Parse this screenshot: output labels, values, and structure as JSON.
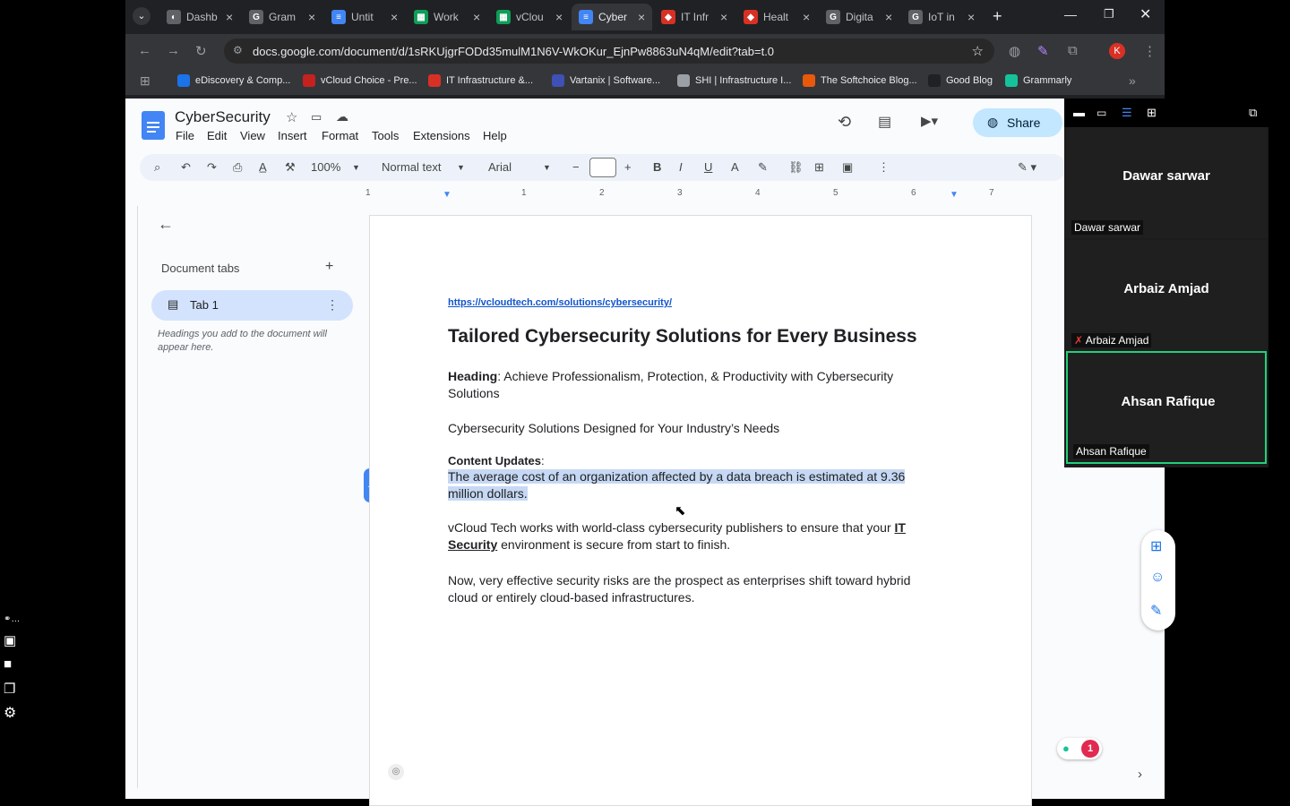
{
  "tabs": [
    {
      "title": "Dashb",
      "color": "#5f6368",
      "glyph": "◐"
    },
    {
      "title": "Gram",
      "color": "#5f6368",
      "glyph": "G"
    },
    {
      "title": "Untit",
      "color": "#4285f4",
      "glyph": "≡"
    },
    {
      "title": "Work",
      "color": "#0f9d58",
      "glyph": "▦"
    },
    {
      "title": "vClou",
      "color": "#0f9d58",
      "glyph": "▦"
    },
    {
      "title": "Cyber",
      "color": "#4285f4",
      "glyph": "≡"
    },
    {
      "title": "IT Infr",
      "color": "#d93025",
      "glyph": "◆"
    },
    {
      "title": "Healt",
      "color": "#d93025",
      "glyph": "◆"
    },
    {
      "title": "Digita",
      "color": "#5f6368",
      "glyph": "G"
    },
    {
      "title": "IoT in",
      "color": "#5f6368",
      "glyph": "G"
    }
  ],
  "address": "docs.google.com/document/d/1sRKUjgrFODd35mulM1N6V-WkOKur_EjnPw8863uN4qM/edit?tab=t.0",
  "bookmarks": [
    {
      "label": "eDiscovery & Comp...",
      "color": "#1a73e8"
    },
    {
      "label": "vCloud Choice - Pre...",
      "color": "#c5221f"
    },
    {
      "label": "IT Infrastructure &...",
      "color": "#d93025"
    },
    {
      "label": "Vartanix | Software...",
      "color": "#3f51b5"
    },
    {
      "label": "SHI | Infrastructure I...",
      "color": "#9aa0a6"
    },
    {
      "label": "The Softchoice Blog...",
      "color": "#e8590c"
    },
    {
      "label": "Good Blog",
      "color": "#202124"
    },
    {
      "label": "Grammarly",
      "color": "#15c39a"
    }
  ],
  "doc": {
    "title": "CyberSecurity",
    "menu": [
      "File",
      "Edit",
      "View",
      "Insert",
      "Format",
      "Tools",
      "Extensions",
      "Help"
    ],
    "share_label": "Share",
    "zoom": "100%",
    "style": "Normal text",
    "font": "Arial",
    "ruler_numbers": [
      "1",
      "1",
      "2",
      "3",
      "4",
      "5",
      "6",
      "7"
    ]
  },
  "side": {
    "header": "Document tabs",
    "tab_label": "Tab 1",
    "hint": "Headings you add to the document will appear here."
  },
  "content": {
    "link": "https://vcloudtech.com/solutions/cybersecurity/",
    "h1": "Tailored Cybersecurity Solutions for Every Business",
    "heading_label": "Heading",
    "heading_text": ": Achieve Professionalism, Protection, & Productivity with Cybersecurity Solutions",
    "p2": "Cybersecurity Solutions Designed for Your Industry’s Needs",
    "cu_label": "Content Updates",
    "cu_colon": ":",
    "highlight": "The average cost of an organization affected by a data breach is estimated at 9.36 million dollars.",
    "p4_a": "vCloud Tech works with world-class cybersecurity publishers to ensure that your ",
    "p4_b": "IT Security",
    "p4_c": " environment is secure from start to finish.",
    "p5": "Now, very effective security risks are the prospect as enterprises shift toward hybrid cloud or entirely cloud-based infrastructures."
  },
  "participants": [
    {
      "name": "Dawar sarwar",
      "label": "Dawar sarwar"
    },
    {
      "name": "Arbaiz Amjad",
      "label": "Arbaiz Amjad"
    },
    {
      "name": "Ahsan Rafique",
      "label": "Ahsan Rafique"
    }
  ],
  "badge_count": "1",
  "profile_initial": "K"
}
